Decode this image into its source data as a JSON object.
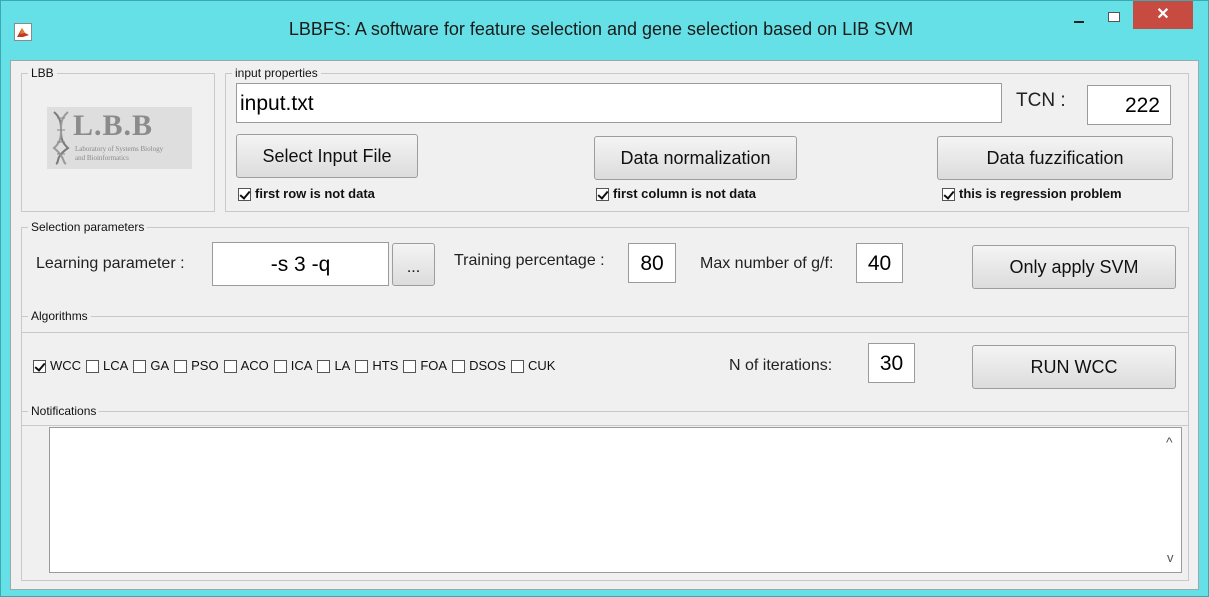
{
  "window": {
    "title": "LBBFS: A software for feature selection and gene selection based on LIB SVM",
    "close_glyph": "✕"
  },
  "lbb_group": {
    "label": "LBB",
    "logo_text": "L.B.B",
    "logo_subtitle_1": "Laboratory of Systems Biology",
    "logo_subtitle_2": "and Bioinformatics"
  },
  "input_properties": {
    "label": "input properties",
    "file_value": "input.txt",
    "tcn_label": "TCN :",
    "tcn_value": "222",
    "select_button": "Select Input File",
    "normalize_button": "Data normalization",
    "fuzzify_button": "Data fuzzification",
    "first_row_checkbox": {
      "label": "first row is not data",
      "checked": true
    },
    "first_column_checkbox": {
      "label": "first column is not data",
      "checked": true
    },
    "regression_checkbox": {
      "label": "this is regression problem",
      "checked": true
    }
  },
  "selection_parameters": {
    "label": "Selection parameters",
    "learning_label": "Learning parameter :",
    "learning_value": "-s 3 -q",
    "ellipsis_button": "...",
    "training_label": "Training percentage :",
    "training_value": "80",
    "max_label": "Max number of g/f:",
    "max_value": "40",
    "svm_button": "Only apply SVM"
  },
  "algorithms": {
    "label": "Algorithms",
    "items": [
      {
        "label": "WCC",
        "checked": true
      },
      {
        "label": "LCA",
        "checked": false
      },
      {
        "label": "GA",
        "checked": false
      },
      {
        "label": "PSO",
        "checked": false
      },
      {
        "label": "ACO",
        "checked": false
      },
      {
        "label": "ICA",
        "checked": false
      },
      {
        "label": "LA",
        "checked": false
      },
      {
        "label": "HTS",
        "checked": false
      },
      {
        "label": "FOA",
        "checked": false
      },
      {
        "label": "DSOS",
        "checked": false
      },
      {
        "label": "CUK",
        "checked": false
      }
    ],
    "iterations_label": "N of iterations:",
    "iterations_value": "30",
    "run_button": "RUN WCC"
  },
  "notifications": {
    "label": "Notifications",
    "text": "",
    "scroll_up": "^",
    "scroll_down": "v"
  }
}
